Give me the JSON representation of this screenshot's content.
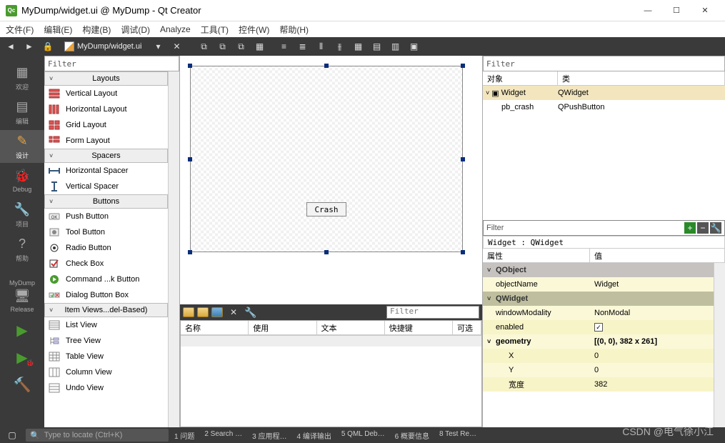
{
  "window": {
    "title": "MyDump/widget.ui @ MyDump - Qt Creator"
  },
  "menu": [
    "文件(F)",
    "编辑(E)",
    "构建(B)",
    "调试(D)",
    "Analyze",
    "工具(T)",
    "控件(W)",
    "帮助(H)"
  ],
  "tab": {
    "path": "MyDump/widget.ui"
  },
  "leftbar": {
    "items": [
      "欢迎",
      "编辑",
      "设计",
      "Debug",
      "项目",
      "帮助"
    ],
    "project": "MyDump",
    "config": "Release"
  },
  "widgetbox": {
    "filter": "Filter",
    "groups": [
      {
        "title": "Layouts",
        "items": [
          "Vertical Layout",
          "Horizontal Layout",
          "Grid Layout",
          "Form Layout"
        ]
      },
      {
        "title": "Spacers",
        "items": [
          "Horizontal Spacer",
          "Vertical Spacer"
        ]
      },
      {
        "title": "Buttons",
        "items": [
          "Push Button",
          "Tool Button",
          "Radio Button",
          "Check Box",
          "Command ...k Button",
          "Dialog Button Box"
        ]
      },
      {
        "title": "Item Views...del-Based)",
        "items": [
          "List View",
          "Tree View",
          "Table View",
          "Column View",
          "Undo View"
        ]
      }
    ]
  },
  "form": {
    "button_label": "Crash"
  },
  "actions": {
    "filter": "Filter",
    "cols": [
      "名称",
      "使用",
      "文本",
      "快捷键",
      "可选"
    ]
  },
  "obj_inspector": {
    "filter": "Filter",
    "cols": [
      "对象",
      "类"
    ],
    "rows": [
      {
        "name": "Widget",
        "cls": "QWidget",
        "sel": true,
        "indent": 0,
        "exp": true
      },
      {
        "name": "pb_crash",
        "cls": "QPushButton",
        "sel": false,
        "indent": 1
      }
    ]
  },
  "prop_editor": {
    "filter": "Filter",
    "header": "Widget : QWidget",
    "cols": [
      "属性",
      "值"
    ],
    "rows": [
      {
        "t": "qo",
        "k": "QObject",
        "v": ""
      },
      {
        "t": "y",
        "k": "objectName",
        "v": "Widget"
      },
      {
        "t": "qw",
        "k": "QWidget",
        "v": ""
      },
      {
        "t": "y",
        "k": "windowModality",
        "v": "NonModal"
      },
      {
        "t": "y2",
        "k": "enabled",
        "v": "[check]"
      },
      {
        "t": "y",
        "k": "geometry",
        "v": "[(0, 0), 382 x 261]",
        "exp": true,
        "bold": true
      },
      {
        "t": "y2",
        "k": "X",
        "v": "0",
        "sub": true
      },
      {
        "t": "y",
        "k": "Y",
        "v": "0",
        "sub": true
      },
      {
        "t": "y2",
        "k": "宽度",
        "v": "382",
        "sub": true
      }
    ]
  },
  "status": {
    "locate": "Type to locate (Ctrl+K)",
    "items": [
      "1 问题",
      "2 Search …",
      "3 应用程…",
      "4 编译输出",
      "5 QML Deb…",
      "6 概要信息",
      "8 Test Re…"
    ]
  },
  "watermark": "CSDN @电气徐小江"
}
